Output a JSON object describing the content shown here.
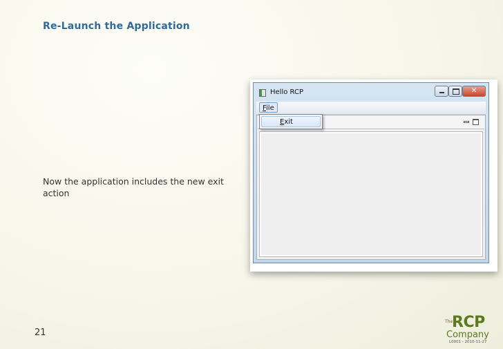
{
  "slide": {
    "title": "Re-Launch the Application",
    "body": "Now the application includes the new exit action",
    "page_number": "21"
  },
  "logo": {
    "the": "The",
    "rcp": "RCP",
    "company": "Company",
    "code": "L0001 - 2010-11-27"
  },
  "app_window": {
    "title": "Hello RCP",
    "menu_file": "File",
    "menu_file_mnemonic": "F",
    "menu_file_rest": "ile",
    "menu_items": [
      {
        "label": "Exit",
        "mnemonic": "E",
        "rest": "xit"
      }
    ],
    "close_glyph": "✕"
  }
}
